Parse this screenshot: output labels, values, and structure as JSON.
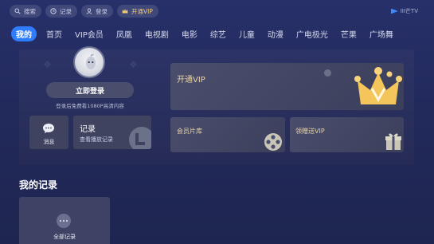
{
  "top_bar": {
    "pills": [
      {
        "label": "搜索",
        "icon": "search-icon"
      },
      {
        "label": "记录",
        "icon": "clock-icon"
      },
      {
        "label": "登录",
        "icon": "user-icon"
      },
      {
        "label": "开通VIP",
        "icon": "vip-crown-icon"
      }
    ],
    "brand": "III芒TV"
  },
  "nav": {
    "tabs": [
      "我的",
      "首页",
      "VIP会员",
      "凤凰",
      "电视剧",
      "电影",
      "综艺",
      "儿童",
      "动漫",
      "广电极光",
      "芒果",
      "广场舞"
    ],
    "active_index": 0
  },
  "account": {
    "login_button": "立即登录",
    "login_hint": "登录后免费看1080P高清内容",
    "messages_label": "消息",
    "records_title": "记录",
    "records_subtitle": "查看播放记录"
  },
  "promo": {
    "vip_title": "开通VIP",
    "library_title": "会员片库",
    "gift_title": "领赠送VIP"
  },
  "history": {
    "section_title": "我的记录",
    "all_records_label": "全部记录"
  },
  "colors": {
    "accent": "#2f7dff",
    "vip_text": "#e8d3a6",
    "crown_gold": "#f3c55a"
  }
}
